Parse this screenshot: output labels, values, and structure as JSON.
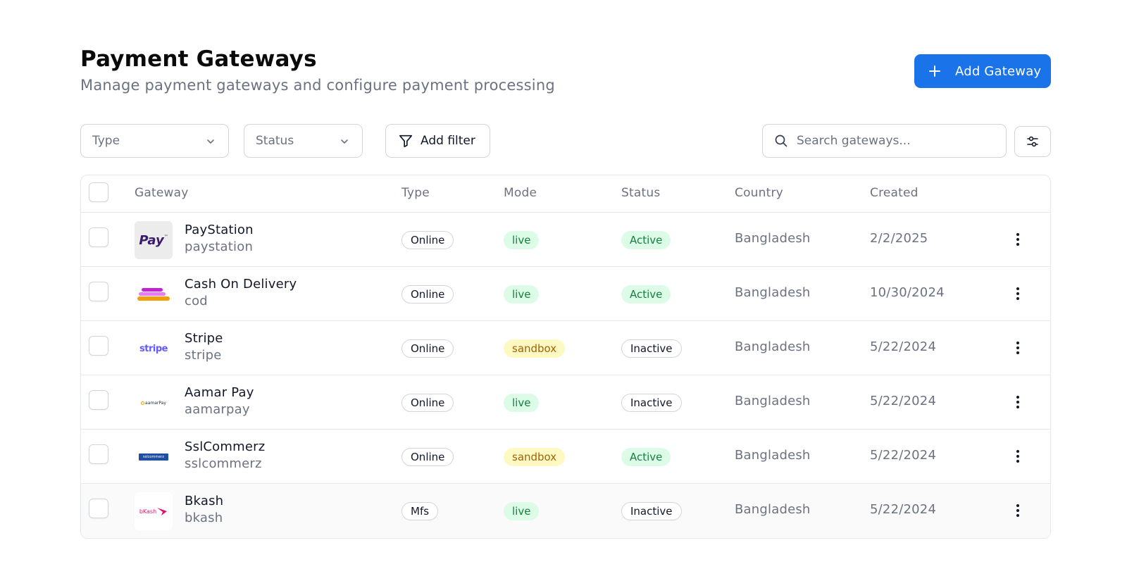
{
  "header": {
    "title": "Payment Gateways",
    "subtitle": "Manage payment gateways and configure payment processing",
    "add_button_label": "Add Gateway"
  },
  "filters": {
    "type_label": "Type",
    "status_label": "Status",
    "add_filter_label": "Add filter",
    "search_placeholder": "Search gateways..."
  },
  "table": {
    "columns": [
      "Gateway",
      "Type",
      "Mode",
      "Status",
      "Country",
      "Created"
    ],
    "rows": [
      {
        "name": "PayStation",
        "slug": "paystation",
        "logo": "paystation-logo",
        "logo_text": "Pay",
        "type": "Online",
        "mode": "live",
        "status": "Active",
        "country": "Bangladesh",
        "created": "2/2/2025"
      },
      {
        "name": "Cash On Delivery",
        "slug": "cod",
        "logo": "cod-logo",
        "type": "Online",
        "mode": "live",
        "status": "Active",
        "country": "Bangladesh",
        "created": "10/30/2024"
      },
      {
        "name": "Stripe",
        "slug": "stripe",
        "logo": "stripe-logo",
        "logo_text": "stripe",
        "type": "Online",
        "mode": "sandbox",
        "status": "Inactive",
        "country": "Bangladesh",
        "created": "5/22/2024"
      },
      {
        "name": "Aamar Pay",
        "slug": "aamarpay",
        "logo": "aamarpay-logo",
        "logo_text": "aamarPay",
        "type": "Online",
        "mode": "live",
        "status": "Inactive",
        "country": "Bangladesh",
        "created": "5/22/2024"
      },
      {
        "name": "SslCommerz",
        "slug": "sslcommerz",
        "logo": "sslcommerz-logo",
        "logo_text": "sslcommerz",
        "type": "Online",
        "mode": "sandbox",
        "status": "Active",
        "country": "Bangladesh",
        "created": "5/22/2024"
      },
      {
        "name": "Bkash",
        "slug": "bkash",
        "logo": "bkash-logo",
        "logo_text": "bKash",
        "type": "Mfs",
        "mode": "live",
        "status": "Inactive",
        "country": "Bangladesh",
        "created": "5/22/2024"
      }
    ]
  },
  "colors": {
    "primary": "#1a73e8",
    "live_bg": "#dcfce7",
    "live_text": "#15803d",
    "sandbox_bg": "#fef9c3",
    "sandbox_text": "#a16207"
  },
  "icons": [
    "plus-icon",
    "chevron-down-icon",
    "filter-icon",
    "search-icon",
    "sliders-icon",
    "more-vertical-icon"
  ]
}
